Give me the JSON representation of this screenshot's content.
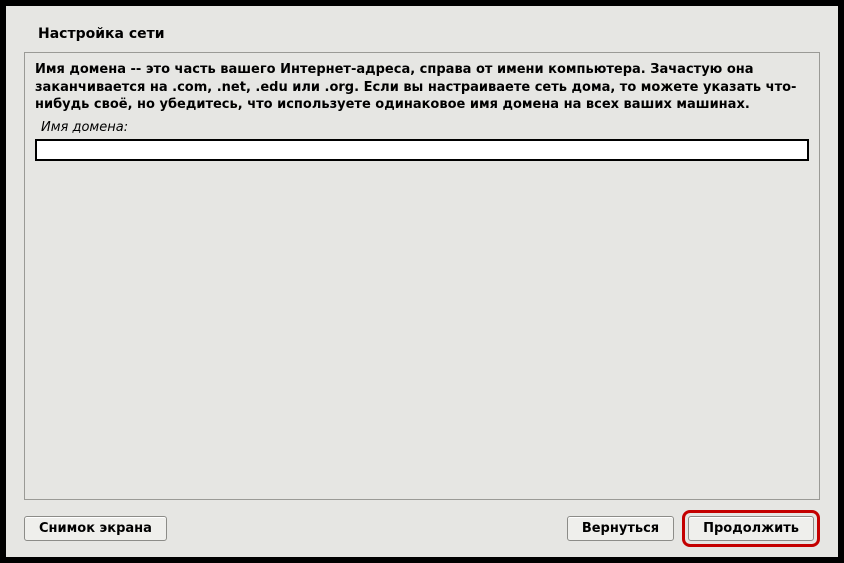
{
  "title": "Настройка сети",
  "description": "Имя домена -- это часть вашего Интернет-адреса, справа от имени компьютера. Зачастую она заканчивается на .com, .net, .edu или .org. Если вы настраиваете сеть дома, то можете указать что-нибудь своё, но убедитесь, что используете одинаковое имя домена на всех ваших машинах.",
  "field": {
    "label": "Имя домена:",
    "value": ""
  },
  "buttons": {
    "screenshot": "Снимок экрана",
    "back": "Вернуться",
    "continue": "Продолжить"
  }
}
